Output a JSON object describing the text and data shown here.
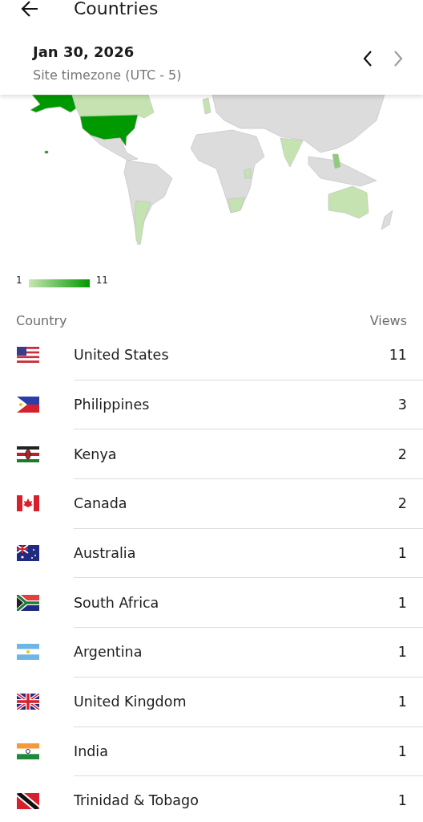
{
  "app_bar": {
    "title": "Countries"
  },
  "date_bar": {
    "date": "Jan 30, 2026",
    "timezone": "Site timezone (UTC - 5)",
    "previous": {
      "disabled": false
    },
    "next": {
      "disabled": true
    }
  },
  "legend": {
    "min": "1",
    "max": "11"
  },
  "table": {
    "columns": [
      "Country",
      "Views"
    ],
    "rows": [
      {
        "kind": "us",
        "country": "United States",
        "views": "11"
      },
      {
        "kind": "ph",
        "country": "Philippines",
        "views": "3"
      },
      {
        "kind": "ke",
        "country": "Kenya",
        "views": "2"
      },
      {
        "kind": "ca",
        "country": "Canada",
        "views": "2"
      },
      {
        "kind": "au",
        "country": "Australia",
        "views": "1"
      },
      {
        "kind": "za",
        "country": "South Africa",
        "views": "1"
      },
      {
        "kind": "ar",
        "country": "Argentina",
        "views": "1"
      },
      {
        "kind": "gb",
        "country": "United Kingdom",
        "views": "1"
      },
      {
        "kind": "in",
        "country": "India",
        "views": "1"
      },
      {
        "kind": "tt",
        "country": "Trinidad & Tobago",
        "views": "1"
      }
    ]
  }
}
